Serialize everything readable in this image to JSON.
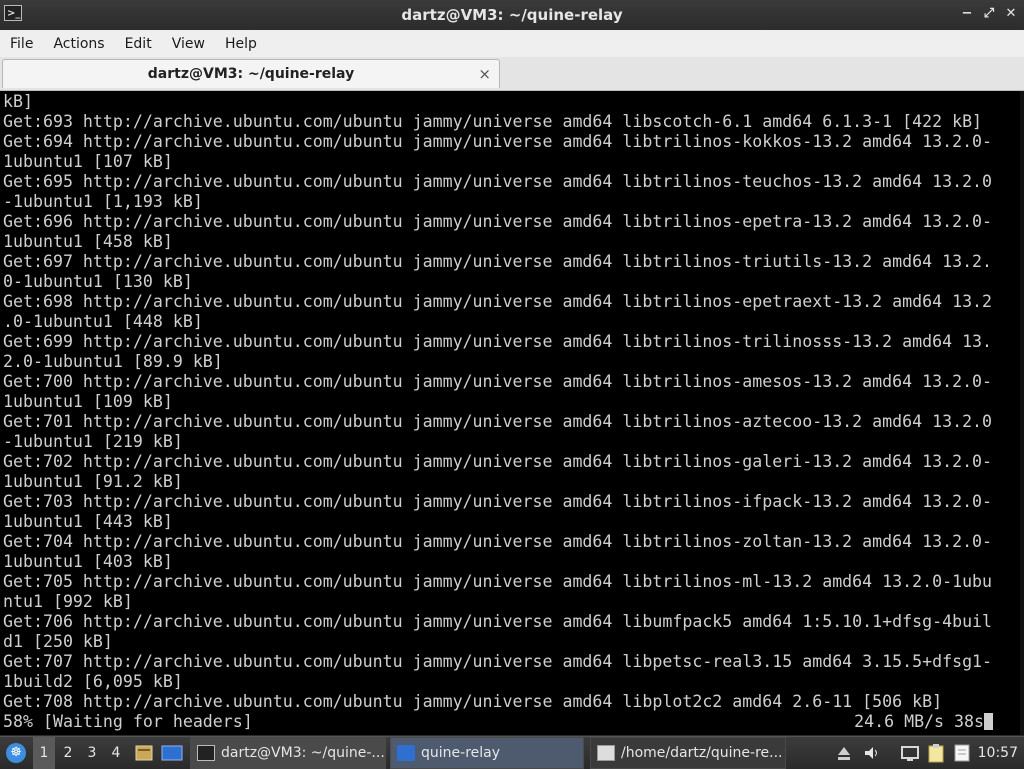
{
  "window": {
    "title": "dartz@VM3: ~/quine-relay",
    "controls": {
      "minimize": "−",
      "maximize": "⤢",
      "close": "✕"
    }
  },
  "menu": [
    "File",
    "Actions",
    "Edit",
    "View",
    "Help"
  ],
  "tab": {
    "label": "dartz@VM3: ~/quine-relay",
    "close": "×"
  },
  "terminal": {
    "lines": [
      "kB]",
      "Get:693 http://archive.ubuntu.com/ubuntu jammy/universe amd64 libscotch-6.1 amd64 6.1.3-1 [422 kB]",
      "Get:694 http://archive.ubuntu.com/ubuntu jammy/universe amd64 libtrilinos-kokkos-13.2 amd64 13.2.0-",
      "1ubuntu1 [107 kB]",
      "Get:695 http://archive.ubuntu.com/ubuntu jammy/universe amd64 libtrilinos-teuchos-13.2 amd64 13.2.0",
      "-1ubuntu1 [1,193 kB]",
      "Get:696 http://archive.ubuntu.com/ubuntu jammy/universe amd64 libtrilinos-epetra-13.2 amd64 13.2.0-",
      "1ubuntu1 [458 kB]",
      "Get:697 http://archive.ubuntu.com/ubuntu jammy/universe amd64 libtrilinos-triutils-13.2 amd64 13.2.",
      "0-1ubuntu1 [130 kB]",
      "Get:698 http://archive.ubuntu.com/ubuntu jammy/universe amd64 libtrilinos-epetraext-13.2 amd64 13.2",
      ".0-1ubuntu1 [448 kB]",
      "Get:699 http://archive.ubuntu.com/ubuntu jammy/universe amd64 libtrilinos-trilinosss-13.2 amd64 13.",
      "2.0-1ubuntu1 [89.9 kB]",
      "Get:700 http://archive.ubuntu.com/ubuntu jammy/universe amd64 libtrilinos-amesos-13.2 amd64 13.2.0-",
      "1ubuntu1 [109 kB]",
      "Get:701 http://archive.ubuntu.com/ubuntu jammy/universe amd64 libtrilinos-aztecoo-13.2 amd64 13.2.0",
      "-1ubuntu1 [219 kB]",
      "Get:702 http://archive.ubuntu.com/ubuntu jammy/universe amd64 libtrilinos-galeri-13.2 amd64 13.2.0-",
      "1ubuntu1 [91.2 kB]",
      "Get:703 http://archive.ubuntu.com/ubuntu jammy/universe amd64 libtrilinos-ifpack-13.2 amd64 13.2.0-",
      "1ubuntu1 [443 kB]",
      "Get:704 http://archive.ubuntu.com/ubuntu jammy/universe amd64 libtrilinos-zoltan-13.2 amd64 13.2.0-",
      "1ubuntu1 [403 kB]",
      "Get:705 http://archive.ubuntu.com/ubuntu jammy/universe amd64 libtrilinos-ml-13.2 amd64 13.2.0-1ubu",
      "ntu1 [992 kB]",
      "Get:706 http://archive.ubuntu.com/ubuntu jammy/universe amd64 libumfpack5 amd64 1:5.10.1+dfsg-4buil",
      "d1 [250 kB]",
      "Get:707 http://archive.ubuntu.com/ubuntu jammy/universe amd64 libpetsc-real3.15 amd64 3.15.5+dfsg1-",
      "1build2 [6,095 kB]",
      "Get:708 http://archive.ubuntu.com/ubuntu jammy/universe amd64 libplot2c2 amd64 2.6-11 [506 kB]"
    ],
    "status_left": "58% [Waiting for headers]",
    "status_right": "24.6 MB/s 38s"
  },
  "taskbar": {
    "start_icon": "☸",
    "workspaces": [
      "1",
      "2",
      "3",
      "4"
    ],
    "active_workspace": "1",
    "tasks": [
      {
        "label": "dartz@VM3: ~/quine-...",
        "icon": "terminal-icon"
      },
      {
        "label": "quine-relay",
        "icon": "folder-icon"
      },
      {
        "label": "/home/dartz/quine-re...",
        "icon": "text-editor-icon"
      }
    ],
    "clock": "10:57"
  },
  "colors": {
    "terminal_bg": "#000000",
    "terminal_fg": "#cfcfcf",
    "taskbar_bg": "#2f2f2f",
    "folder_blue": "#2f6fd0"
  }
}
